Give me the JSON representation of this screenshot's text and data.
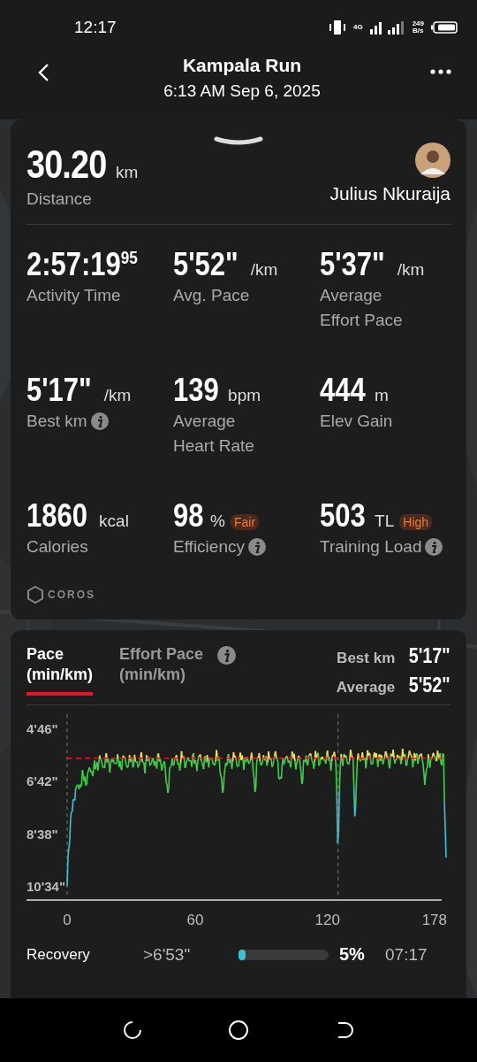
{
  "status_bar": {
    "time": "12:17",
    "network": "4G",
    "speed": "249",
    "speed_unit": "B/s"
  },
  "header": {
    "title": "Kampala Run",
    "subtitle": "6:13 AM Sep 6, 2025"
  },
  "summary": {
    "distance": "30.20",
    "distance_unit": "km",
    "distance_label": "Distance",
    "athlete": "Julius Nkuraija"
  },
  "stats": [
    {
      "value": "2:57:19",
      "value_sup": "95",
      "label": "Activity Time",
      "info": false
    },
    {
      "value": "5'52\"",
      "unit": "/km",
      "label": "Avg. Pace",
      "info": false
    },
    {
      "value": "5'37\"",
      "unit": "/km",
      "label": "Average Effort Pace",
      "info": false
    },
    {
      "value": "5'17\"",
      "unit": "/km",
      "label": "Best km",
      "info": true
    },
    {
      "value": "139",
      "unit": "bpm",
      "label": "Average Heart Rate",
      "info": false
    },
    {
      "value": "444",
      "unit": "m",
      "label": "Elev Gain",
      "info": false
    },
    {
      "value": "1860",
      "unit": "kcal",
      "label": "Calories",
      "info": false
    },
    {
      "value": "98",
      "unit": "%",
      "badge": "Fair",
      "label": "Efficiency",
      "info": true
    },
    {
      "value": "503",
      "unit": "TL",
      "badge": "High",
      "label": "Training Load",
      "info": true
    }
  ],
  "brand": "COROS",
  "pace_panel": {
    "tabs": [
      {
        "label": "Pace",
        "sublabel": "(min/km)",
        "selected": true,
        "info": false
      },
      {
        "label": "Effort Pace",
        "sublabel": "(min/km)",
        "selected": false,
        "info": true
      }
    ],
    "highlights": [
      {
        "label": "Best km",
        "value": "5'17\""
      },
      {
        "label": "Average",
        "value": "5'52\""
      }
    ],
    "y_ticks": [
      "4'46\"",
      "6'42\"",
      "8'38\"",
      "10'34\""
    ],
    "x_ticks": [
      "0",
      "60",
      "120",
      "178"
    ],
    "recovery": {
      "label": "Recovery",
      "threshold": ">6'53\"",
      "level": 0.05,
      "percent": "5%",
      "time": "07:17"
    }
  }
}
